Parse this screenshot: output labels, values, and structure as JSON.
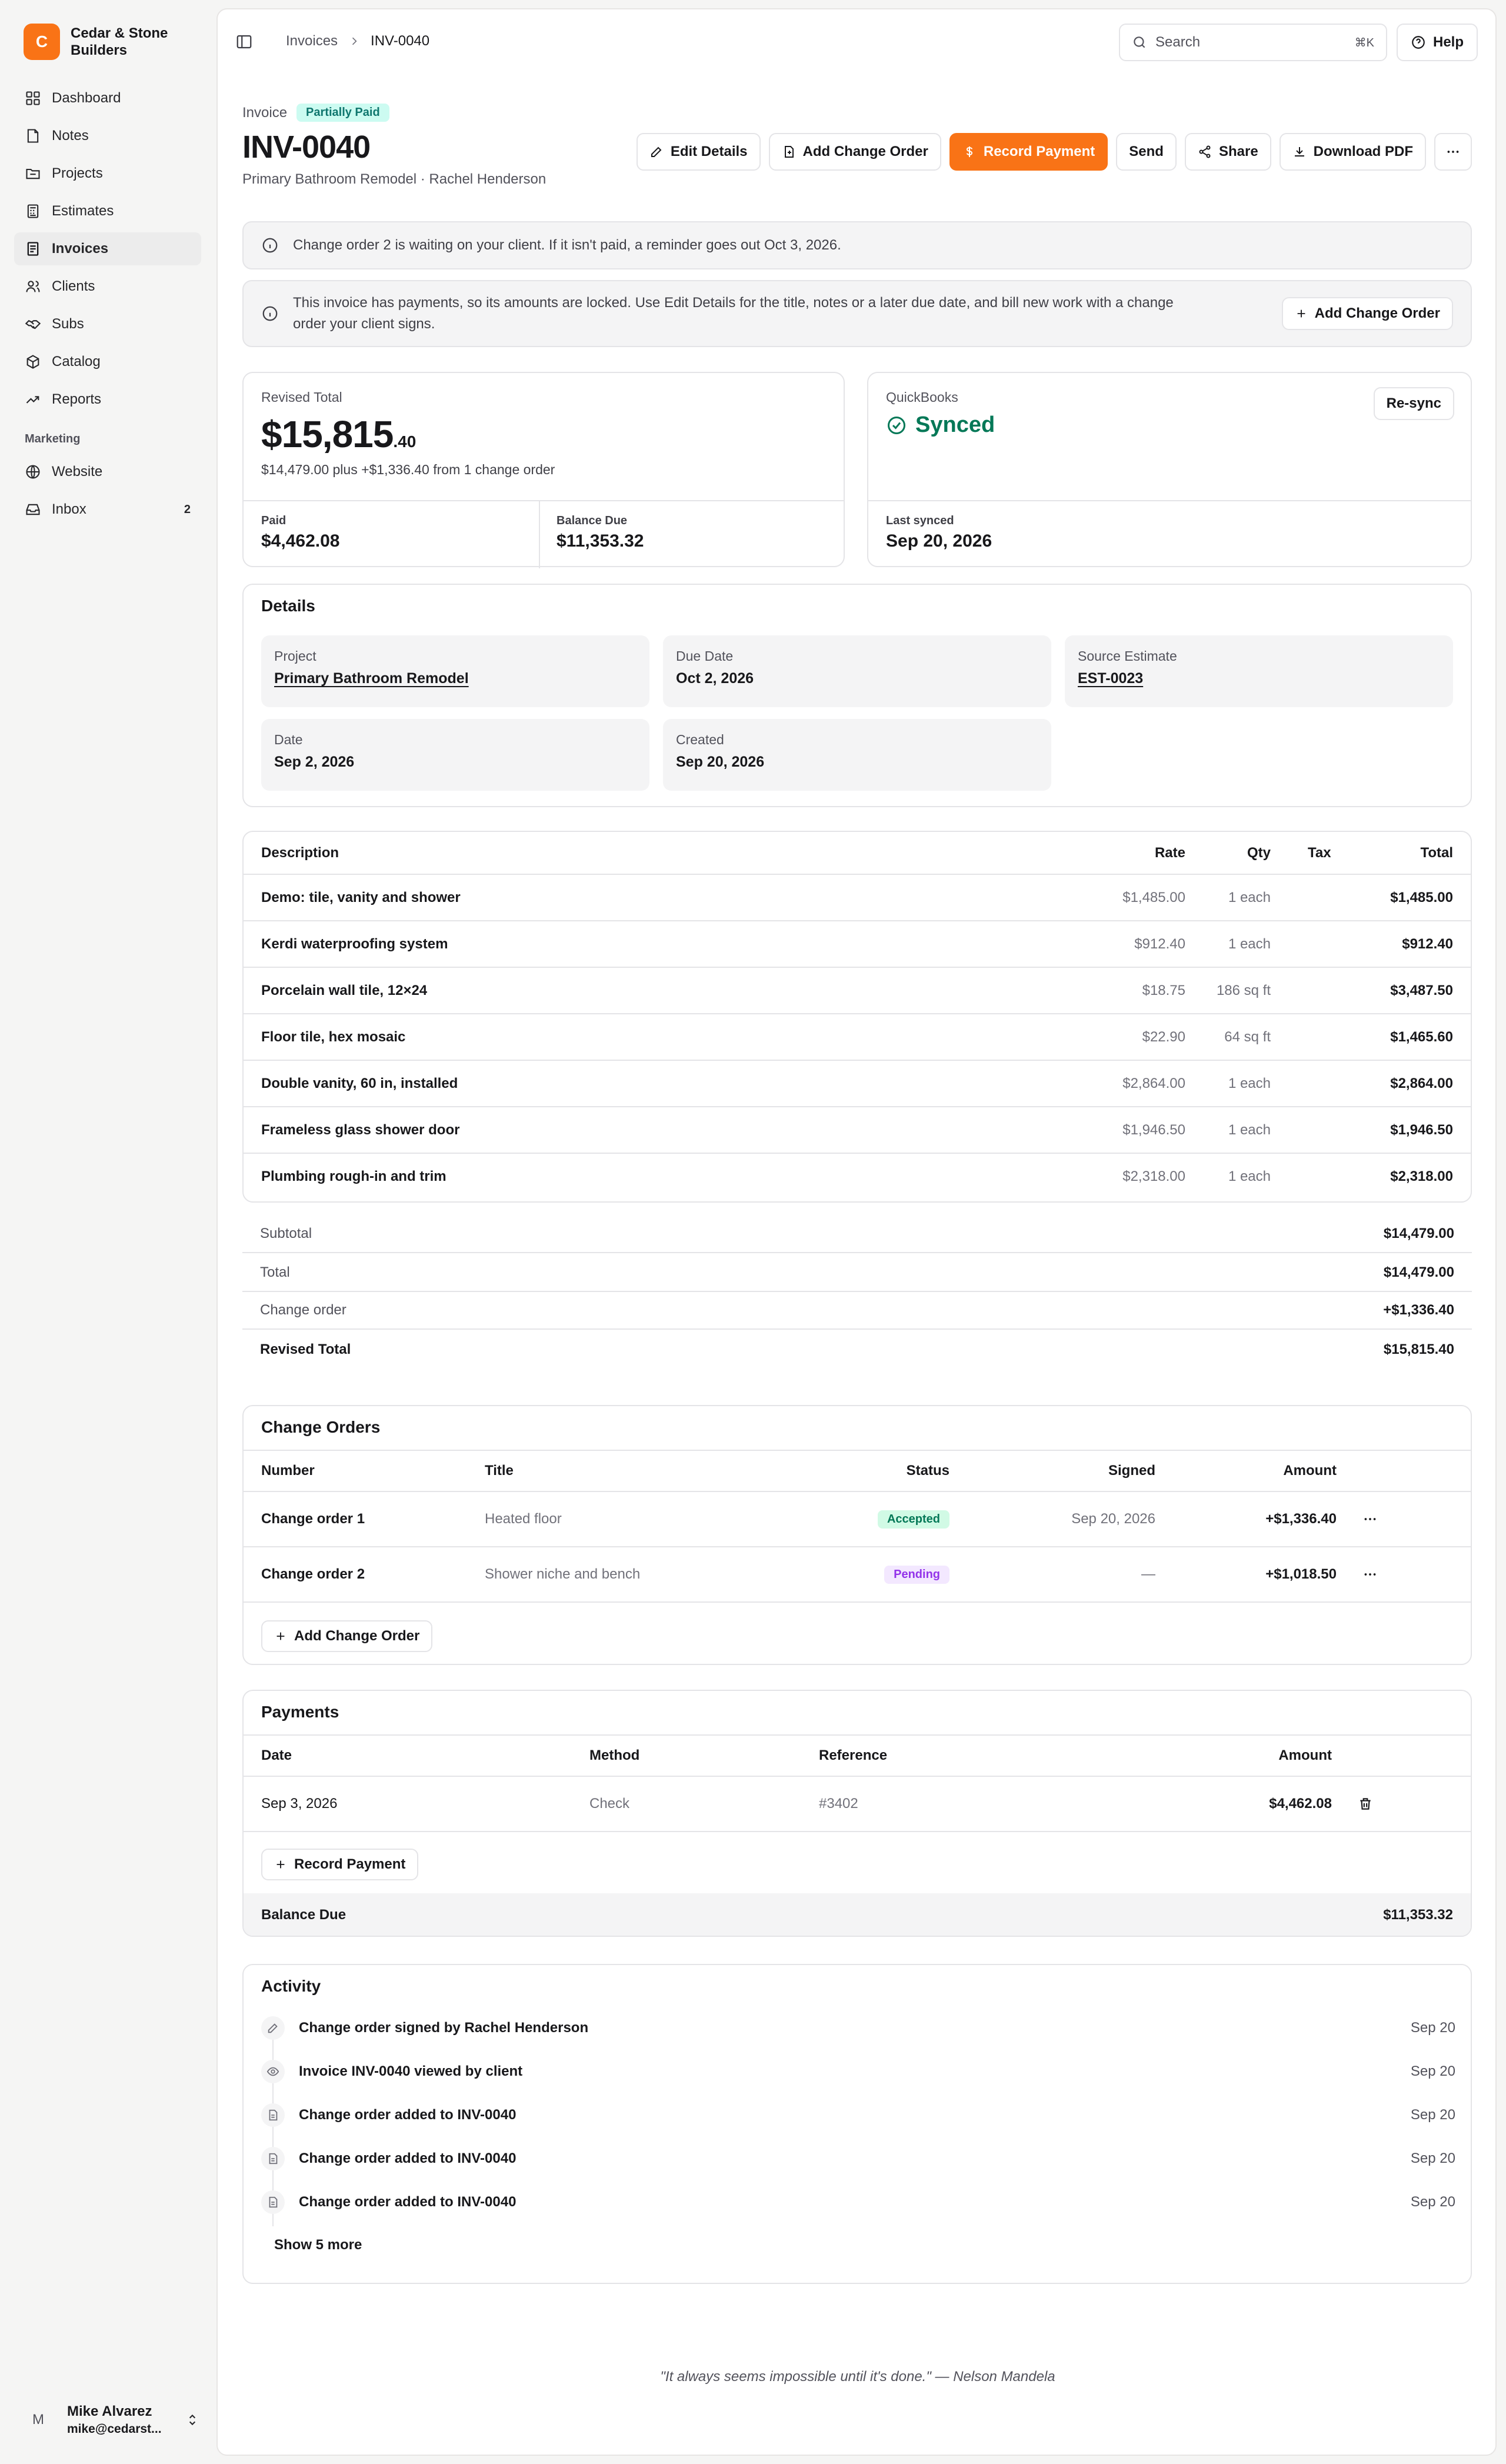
{
  "brand": {
    "initial": "C",
    "name": "Cedar & Stone Builders"
  },
  "nav": [
    {
      "label": "Dashboard",
      "icon": "grid-icon"
    },
    {
      "label": "Notes",
      "icon": "note-icon"
    },
    {
      "label": "Projects",
      "icon": "folder-icon"
    },
    {
      "label": "Estimates",
      "icon": "calculator-icon"
    },
    {
      "label": "Invoices",
      "icon": "invoice-icon",
      "active": true
    },
    {
      "label": "Clients",
      "icon": "users-icon"
    },
    {
      "label": "Subs",
      "icon": "handshake-icon"
    },
    {
      "label": "Catalog",
      "icon": "box-icon"
    },
    {
      "label": "Reports",
      "icon": "trend-icon"
    }
  ],
  "marketing": {
    "section_label": "Marketing",
    "items": [
      {
        "label": "Website",
        "icon": "globe-icon"
      },
      {
        "label": "Inbox",
        "icon": "inbox-icon",
        "badge": "2"
      }
    ]
  },
  "user": {
    "initial": "M",
    "name": "Mike Alvarez",
    "email": "mike@cedarst..."
  },
  "breadcrumb": {
    "parent": "Invoices",
    "current": "INV-0040"
  },
  "search": {
    "placeholder": "Search",
    "shortcut": "⌘K"
  },
  "help_label": "Help",
  "invoice": {
    "kicker": "Invoice",
    "status": "Partially Paid",
    "number": "INV-0040",
    "subtitle": "Primary Bathroom Remodel · Rachel Henderson"
  },
  "actions": {
    "edit": "Edit Details",
    "add_change_order": "Add Change Order",
    "record_payment": "Record Payment",
    "send": "Send",
    "share": "Share",
    "download": "Download PDF"
  },
  "alerts": {
    "reminder": "Change order 2 is waiting on your client. If it isn't paid, a reminder goes out Oct 3, 2026.",
    "locked_line1": "This invoice has payments, so its amounts are locked. Use Edit Details for the title, notes or a later due date, and bill new work with a change",
    "locked_line2": "order your client signs.",
    "locked_button": "Add Change Order"
  },
  "totals_card": {
    "label": "Revised Total",
    "amount_main": "$15,815",
    "amount_cents": ".40",
    "breakdown": "$14,479.00 plus +$1,336.40 from 1 change order",
    "paid_label": "Paid",
    "paid_value": "$4,462.08",
    "balance_label": "Balance Due",
    "balance_value": "$11,353.32"
  },
  "qb_card": {
    "label": "QuickBooks",
    "status": "Synced",
    "resync": "Re-sync",
    "last_label": "Last synced",
    "last_value": "Sep 20, 2026"
  },
  "details": {
    "title": "Details",
    "project_label": "Project",
    "project_value": "Primary Bathroom Remodel",
    "due_label": "Due Date",
    "due_value": "Oct 2, 2026",
    "source_label": "Source Estimate",
    "source_value": "EST-0023",
    "date_label": "Date",
    "date_value": "Sep 2, 2026",
    "created_label": "Created",
    "created_value": "Sep 20, 2026"
  },
  "line_items": {
    "headers": {
      "description": "Description",
      "rate": "Rate",
      "qty": "Qty",
      "tax": "Tax",
      "total": "Total"
    },
    "rows": [
      {
        "description": "Demo: tile, vanity and shower",
        "rate": "$1,485.00",
        "qty": "1 each",
        "tax": "",
        "total": "$1,485.00"
      },
      {
        "description": "Kerdi waterproofing system",
        "rate": "$912.40",
        "qty": "1 each",
        "tax": "",
        "total": "$912.40"
      },
      {
        "description": "Porcelain wall tile, 12×24",
        "rate": "$18.75",
        "qty": "186 sq ft",
        "tax": "",
        "total": "$3,487.50"
      },
      {
        "description": "Floor tile, hex mosaic",
        "rate": "$22.90",
        "qty": "64 sq ft",
        "tax": "",
        "total": "$1,465.60"
      },
      {
        "description": "Double vanity, 60 in, installed",
        "rate": "$2,864.00",
        "qty": "1 each",
        "tax": "",
        "total": "$2,864.00"
      },
      {
        "description": "Frameless glass shower door",
        "rate": "$1,946.50",
        "qty": "1 each",
        "tax": "",
        "total": "$1,946.50"
      },
      {
        "description": "Plumbing rough-in and trim",
        "rate": "$2,318.00",
        "qty": "1 each",
        "tax": "",
        "total": "$2,318.00"
      }
    ]
  },
  "summary": [
    {
      "label": "Subtotal",
      "value": "$14,479.00"
    },
    {
      "label": "Total",
      "value": "$14,479.00"
    },
    {
      "label": "Change order",
      "value": "+$1,336.40"
    },
    {
      "label": "Revised Total",
      "value": "$15,815.40"
    }
  ],
  "change_orders": {
    "title": "Change Orders",
    "headers": {
      "number": "Number",
      "title": "Title",
      "status": "Status",
      "signed": "Signed",
      "amount": "Amount"
    },
    "rows": [
      {
        "number": "Change order 1",
        "title": "Heated floor",
        "status": "Accepted",
        "signed": "Sep 20, 2026",
        "amount": "+$1,336.40"
      },
      {
        "number": "Change order 2",
        "title": "Shower niche and bench",
        "status": "Pending",
        "signed": "—",
        "amount": "+$1,018.50"
      }
    ],
    "add_label": "Add Change Order"
  },
  "payments": {
    "title": "Payments",
    "headers": {
      "date": "Date",
      "method": "Method",
      "reference": "Reference",
      "amount": "Amount"
    },
    "rows": [
      {
        "date": "Sep 3, 2026",
        "method": "Check",
        "reference": "#3402",
        "amount": "$4,462.08"
      }
    ],
    "record_label": "Record Payment",
    "balance_label": "Balance Due",
    "balance_value": "$11,353.32"
  },
  "activity": {
    "title": "Activity",
    "items": [
      {
        "text": "Change order signed by Rachel Henderson",
        "date": "Sep 20",
        "icon": "pen-icon"
      },
      {
        "text": "Invoice INV-0040 viewed by client",
        "date": "Sep 20",
        "icon": "eye-icon"
      },
      {
        "text": "Change order added to INV-0040",
        "date": "Sep 20",
        "icon": "document-icon"
      },
      {
        "text": "Change order added to INV-0040",
        "date": "Sep 20",
        "icon": "document-icon"
      },
      {
        "text": "Change order added to INV-0040",
        "date": "Sep 20",
        "icon": "document-icon"
      }
    ],
    "show_more": "Show 5 more"
  },
  "quote": "\"It always seems impossible until it's done.\" — Nelson Mandela",
  "colors": {
    "accent": "#f97316",
    "synced": "#047857",
    "surface": "#f4f4f5",
    "border": "#e4e4e7"
  }
}
